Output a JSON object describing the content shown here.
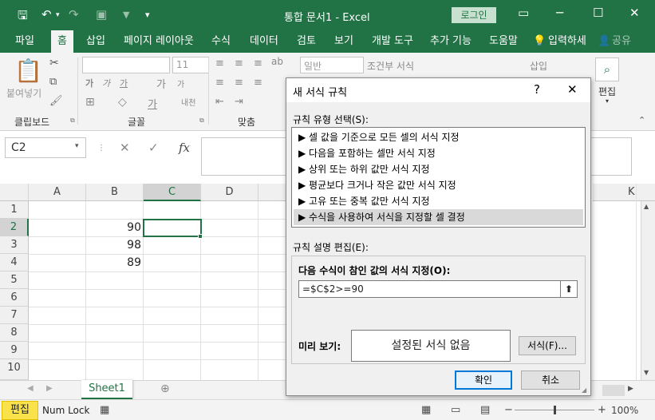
{
  "titlebar": {
    "title": "통합 문서1  -  Excel",
    "login": "로그인"
  },
  "menu": [
    "파일",
    "홈",
    "삽입",
    "페이지 레이아웃",
    "수식",
    "데이터",
    "검토",
    "보기",
    "개발 도구",
    "추가 기능",
    "도움말",
    "입력하세",
    "공유"
  ],
  "ribbon": {
    "paste_label": "붙여넣기",
    "groups": [
      "클립보드",
      "글꼴",
      "맞춤"
    ],
    "font_size": "11",
    "number_format": "일반",
    "conditional_format": "조건부 서식",
    "insert": "삽입",
    "edit": "편집"
  },
  "formula_bar": {
    "name_box": "C2",
    "fx": "fx"
  },
  "grid": {
    "columns": [
      "A",
      "B",
      "C",
      "D",
      "K"
    ],
    "rows": [
      "1",
      "2",
      "3",
      "4",
      "5",
      "6",
      "7",
      "8",
      "9",
      "10"
    ],
    "cells": [
      {
        "ref": "B2",
        "value": "90"
      },
      {
        "ref": "B3",
        "value": "98"
      },
      {
        "ref": "B4",
        "value": "89"
      }
    ],
    "selected_cell": "C2"
  },
  "sheet_tab": "Sheet1",
  "status": {
    "mode": "편집",
    "num_lock": "Num Lock",
    "zoom": "100%"
  },
  "dialog": {
    "title": "새 서식 규칙",
    "help": "?",
    "rule_type_label": "규칙 유형 선택(S):",
    "rule_types": [
      "▶ 셀 값을 기준으로 모든 셀의 서식 지정",
      "▶ 다음을 포함하는 셀만 서식 지정",
      "▶ 상위 또는 하위 값만 서식 지정",
      "▶ 평균보다 크거나 작은 값만 서식 지정",
      "▶ 고유 또는 중복 값만 서식 지정",
      "▶ 수식을 사용하여 서식을 지정할 셀 결정"
    ],
    "selected_rule_index": 5,
    "edit_label": "규칙 설명 편집(E):",
    "formula_label": "다음 수식이 참인 값의 서식 지정(O):",
    "formula_value": "=$C$2>=90",
    "preview_label": "미리 보기:",
    "preview_text": "설정된 서식 없음",
    "format_button": "서식(F)...",
    "ok_button": "확인",
    "cancel_button": "취소"
  },
  "colors": {
    "excel_green": "#217346",
    "dialog_bg": "#f0f0f0",
    "primary_border": "#0078d7"
  }
}
